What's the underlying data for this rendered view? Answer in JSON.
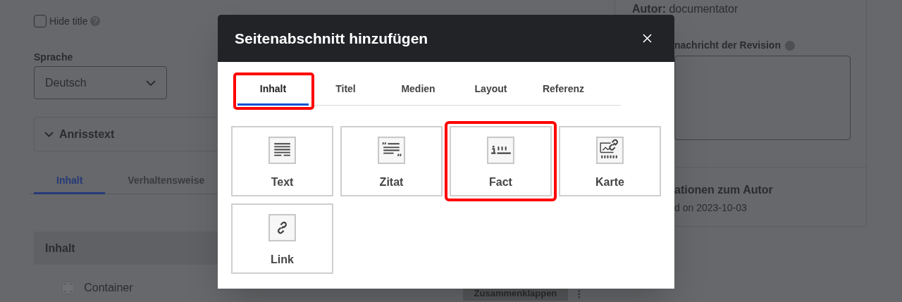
{
  "page": {
    "hide_title": {
      "label": "Hide title",
      "checked": false
    },
    "language": {
      "label": "Sprache",
      "value": "Deutsch"
    },
    "teaser": {
      "label": "Anrisstext"
    },
    "tabs": [
      {
        "label": "Inhalt",
        "selected": true
      },
      {
        "label": "Verhaltensweise",
        "selected": false
      }
    ],
    "section": {
      "title": "Inhalt"
    },
    "item": {
      "label": "Container",
      "button": "Zusammenklappen"
    }
  },
  "sidebar": {
    "author_label": "Autor:",
    "author": "documentator",
    "revision_label": "nachricht der Revision",
    "author_info_title": "ationen zum Autor",
    "author_info_text": "d on 2023-10-03"
  },
  "dialog": {
    "title": "Seitenabschnitt hinzufügen",
    "tabs": [
      {
        "label": "Inhalt",
        "selected": true,
        "highlighted": true
      },
      {
        "label": "Titel",
        "selected": false,
        "highlighted": false
      },
      {
        "label": "Medien",
        "selected": false,
        "highlighted": false
      },
      {
        "label": "Layout",
        "selected": false,
        "highlighted": false
      },
      {
        "label": "Referenz",
        "selected": false,
        "highlighted": false
      }
    ],
    "blocks": [
      {
        "label": "Text",
        "kind": "text",
        "highlighted": false
      },
      {
        "label": "Zitat",
        "kind": "quote",
        "highlighted": false
      },
      {
        "label": "Fact",
        "kind": "fact",
        "highlighted": true
      },
      {
        "label": "Karte",
        "kind": "map",
        "highlighted": false
      },
      {
        "label": "Link",
        "kind": "link",
        "highlighted": false
      }
    ]
  }
}
